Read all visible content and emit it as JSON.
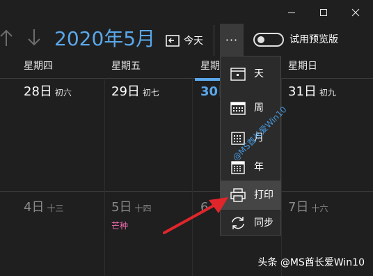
{
  "header": {
    "month_title": "2020年5月",
    "today_label": "今天",
    "more_label": "···",
    "preview_toggle_label": "试用预览版",
    "preview_toggle_on": false
  },
  "weekdays": [
    "星期四",
    "星期五",
    "星期",
    "星期日"
  ],
  "week1": [
    {
      "day": "28日",
      "lunar": "初六"
    },
    {
      "day": "29日",
      "lunar": "初七"
    },
    {
      "day": "30日",
      "lunar": ""
    },
    {
      "day": "31日",
      "lunar": "初九"
    }
  ],
  "week2": [
    {
      "day": "4日",
      "lunar": "十三",
      "term": ""
    },
    {
      "day": "5日",
      "lunar": "十四",
      "term": "芒种"
    },
    {
      "day": "6",
      "lunar": "",
      "term": ""
    },
    {
      "day": "7日",
      "lunar": "十六",
      "term": ""
    }
  ],
  "menu": {
    "items": [
      {
        "label": "天",
        "icon": "day-view-icon"
      },
      {
        "label": "周",
        "icon": "week-view-icon"
      },
      {
        "label": "月",
        "icon": "month-view-icon"
      },
      {
        "label": "年",
        "icon": "year-view-icon"
      },
      {
        "label": "打印",
        "icon": "printer-icon"
      },
      {
        "label": "同步",
        "icon": "sync-icon"
      }
    ],
    "selected": "打印"
  },
  "watermark": "@MS酋长爱Win10",
  "credit": "头条 @MS酋长爱Win10",
  "colors": {
    "accent": "#5aa7ea",
    "solar_term": "#f06bb0",
    "arrow": "#e0262b",
    "background": "#1f1f1f"
  }
}
